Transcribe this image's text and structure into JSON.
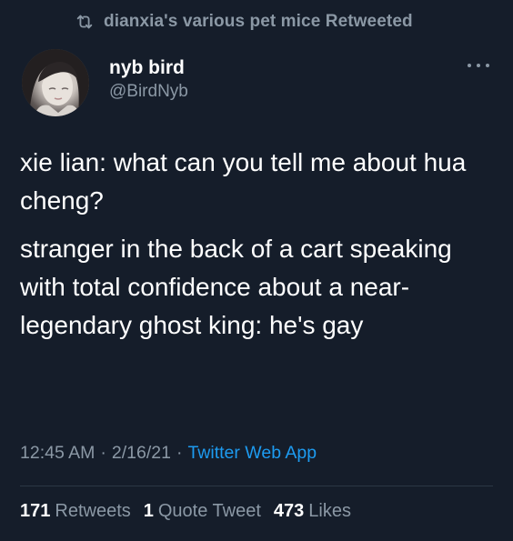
{
  "retweet": {
    "icon": "retweet-icon",
    "text": "dianxia's various pet mice Retweeted"
  },
  "author": {
    "display_name": "nyb bird",
    "handle": "@BirdNyb",
    "avatar": "avatar-photo",
    "more_icon": "more-options-icon"
  },
  "tweet": {
    "paragraphs": [
      "xie lian: what can you tell me about hua cheng?",
      "stranger in the back of a cart speaking with total confidence about a near-legendary ghost king: he's gay"
    ]
  },
  "meta": {
    "time": "12:45 AM",
    "date": "2/16/21",
    "app": "Twitter Web App"
  },
  "stats": {
    "retweets": {
      "count": "171",
      "label": "Retweets"
    },
    "quotes": {
      "count": "1",
      "label": "Quote Tweet"
    },
    "likes": {
      "count": "473",
      "label": "Likes"
    }
  },
  "colors": {
    "background": "#151d2a",
    "secondary_text": "#8b98a5",
    "link": "#1d9bf0",
    "primary_text": "#ffffff"
  }
}
